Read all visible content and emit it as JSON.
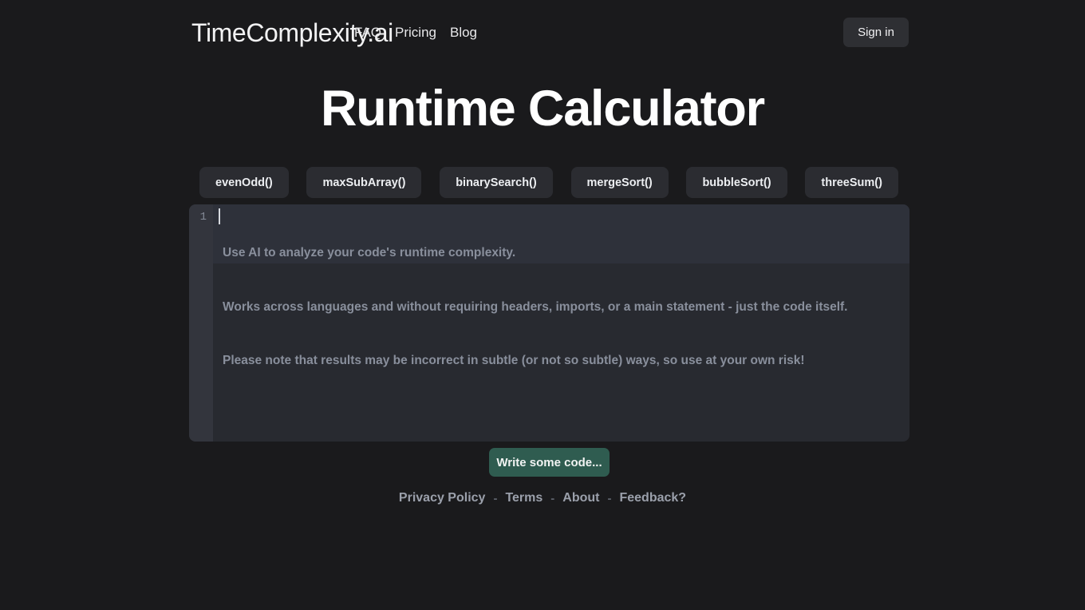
{
  "theme": {
    "page_bg": "#1a1a1c",
    "editor_bg": "#282a30",
    "gutter_bg": "#33353d",
    "highlight_band": "#2e313a",
    "sample_button_bg": "#2b2c31",
    "signin_bg": "#2e2f33",
    "submit_bg": "#2f5c50",
    "title_color": "#ffffff",
    "placeholder_color": "#898f9c",
    "footer_link_color": "#9ba0ab"
  },
  "header": {
    "brand": "TimeComplexity.ai",
    "nav": [
      {
        "label": "FAQ"
      },
      {
        "label": "Pricing"
      },
      {
        "label": "Blog"
      }
    ],
    "signin_label": "Sign in"
  },
  "main": {
    "title": "Runtime Calculator",
    "samples": [
      {
        "label": "evenOdd()"
      },
      {
        "label": "maxSubArray()"
      },
      {
        "label": "binarySearch()"
      },
      {
        "label": "mergeSort()"
      },
      {
        "label": "bubbleSort()"
      },
      {
        "label": "threeSum()"
      }
    ],
    "editor": {
      "line_numbers": [
        "1"
      ],
      "value": "",
      "placeholder_lines": [
        "Use AI to analyze your code's runtime complexity.",
        "Works across languages and without requiring headers, imports, or a main statement - just the code itself.",
        "Please note that results may be incorrect in subtle (or not so subtle) ways, so use at your own risk!"
      ]
    },
    "submit_label": "Write some code..."
  },
  "footer": {
    "separator": "-",
    "links": [
      {
        "label": "Privacy Policy"
      },
      {
        "label": "Terms"
      },
      {
        "label": "About"
      },
      {
        "label": "Feedback?"
      }
    ]
  }
}
